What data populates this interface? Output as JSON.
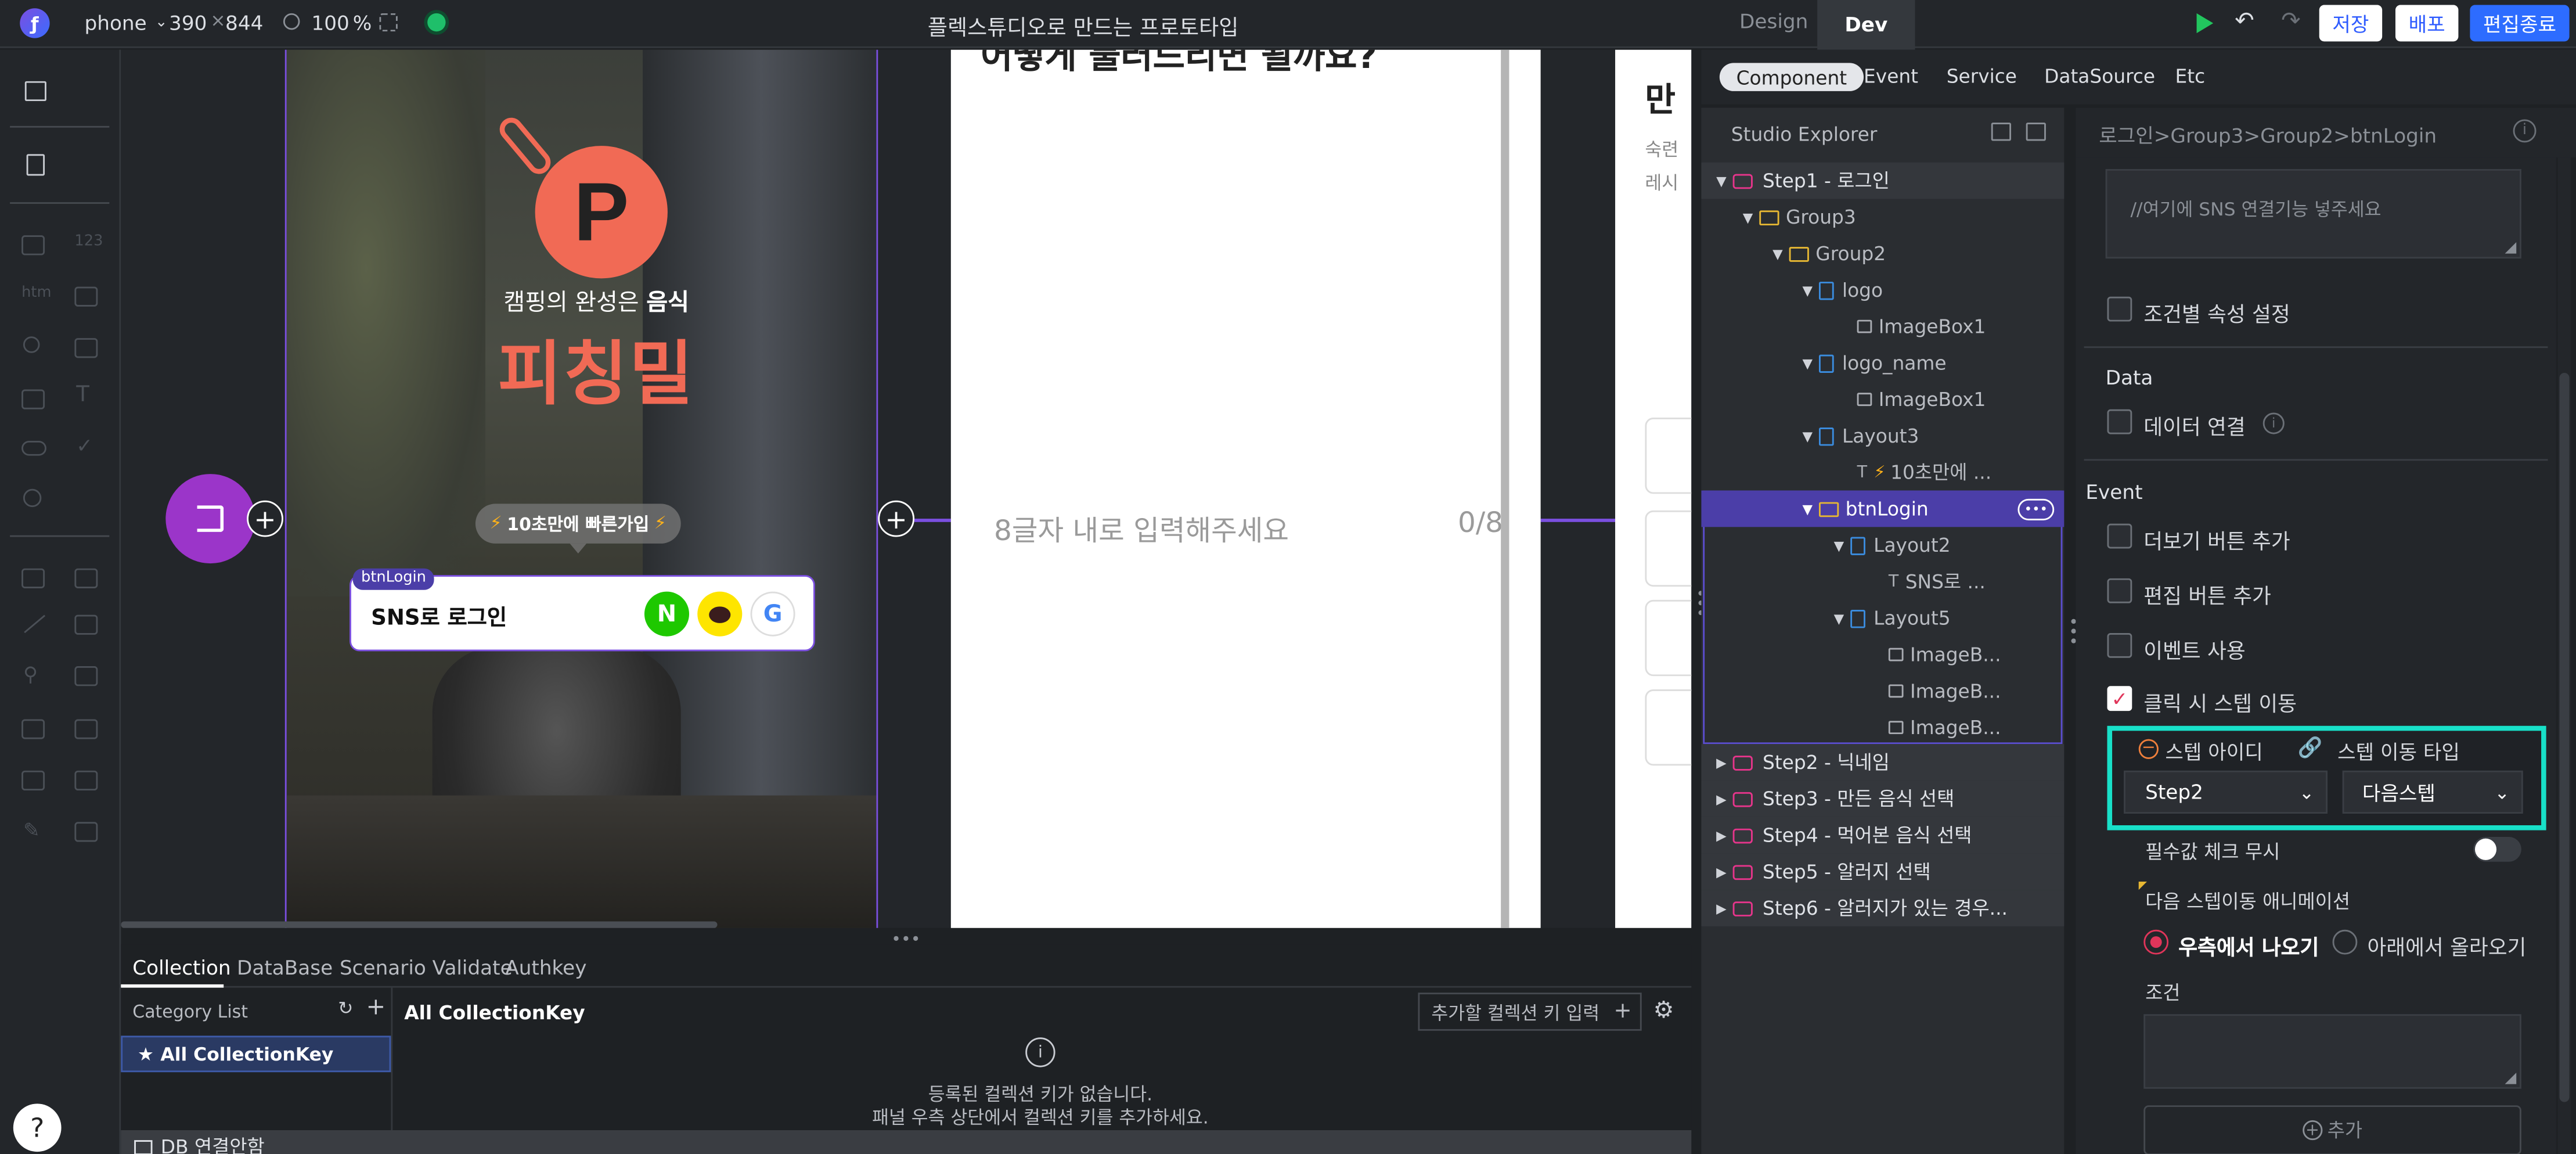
{
  "topbar": {
    "device": "phone",
    "width": "390",
    "height": "844",
    "zoom": "100",
    "zoom_unit": "%",
    "title": "플렉스튜디오로 만드는 프로토타입",
    "tab_design": "Design",
    "tab_dev": "Dev",
    "save": "저장",
    "deploy": "배포",
    "end_edit": "편집종료"
  },
  "subtabs": [
    "Component",
    "Event",
    "Service",
    "DataSource",
    "Etc"
  ],
  "explorer": {
    "title": "Studio Explorer",
    "rows": [
      {
        "label": "Step1 - 로그인"
      },
      {
        "label": "Group3"
      },
      {
        "label": "Group2"
      },
      {
        "label": "logo"
      },
      {
        "label": "ImageBox1"
      },
      {
        "label": "logo_name"
      },
      {
        "label": "ImageBox1"
      },
      {
        "label": "Layout3"
      },
      {
        "label": "10초만에 ..."
      },
      {
        "label": "btnLogin"
      },
      {
        "label": "Layout2"
      },
      {
        "label": "SNS로 ..."
      },
      {
        "label": "Layout5"
      },
      {
        "label": "ImageB..."
      },
      {
        "label": "ImageB..."
      },
      {
        "label": "ImageB..."
      },
      {
        "label": "Step2 - 닉네임"
      },
      {
        "label": "Step3 - 만든 음식 선택"
      },
      {
        "label": "Step4 - 먹어본 음식 선택"
      },
      {
        "label": "Step5 - 알러지 선택"
      },
      {
        "label": "Step6 - 알러지가 있는 경우..."
      }
    ]
  },
  "panel": {
    "breadcrumb": "로그인>Group3>Group2>btnLogin",
    "code_placeholder": "//여기에 SNS 연결기능 넣주세요",
    "cond_attr": "조건별 속성 설정",
    "data_title": "Data",
    "data_link": "데이터 연결",
    "event_title": "Event",
    "more_btn": "더보기 버튼 추가",
    "edit_btn": "편집 버튼 추가",
    "use_event": "이벤트 사용",
    "click_step": "클릭 시 스텝 이동",
    "step_id_label": "스텝 아이디",
    "step_type_label": "스텝 이동 타입",
    "step_id_value": "Step2",
    "step_type_value": "다음스텝",
    "required_skip": "필수값 체크 무시",
    "anim_title": "다음 스텝이동 애니메이션",
    "anim_right": "우측에서 나오기",
    "anim_bottom": "아래에서 올라오기",
    "condition": "조건",
    "add": "추가"
  },
  "canvas": {
    "slogan_pre": "캠핑의 완성은 ",
    "slogan_bold": "음식",
    "brand": "피칭밀",
    "badge": "10초만에 빠른가입",
    "btn_tag": "btnLogin",
    "sns_login": "SNS로 로그인",
    "nick_placeholder": "8글자 내로 입력해주세요",
    "nick_count": "0/8",
    "card2_title": "어떻게 불러드리면 될까요?",
    "card3_title": "만",
    "card3_sub1": "숙련",
    "card3_sub2": "레시"
  },
  "bottom": {
    "tabs": [
      "Collection",
      "DataBase",
      "Scenario Validate",
      "Authkey"
    ],
    "category_list": "Category List",
    "all_key": "All CollectionKey",
    "all_key_title": "All CollectionKey",
    "input_placeholder": "추가할 컬렉션 키 입력",
    "empty1": "등록된 컬렉션 키가 없습니다.",
    "empty2": "패널 우측 상단에서 컬렉션 키를 추가하세요.",
    "db_status": "DB 연결안함"
  },
  "colors": {
    "accent_purple": "#7b4fe0",
    "selected_row": "#4b3ea8",
    "brand_coral": "#f16a55",
    "highlight_teal": "#18e0c8",
    "save_blue": "#2d6cff"
  }
}
